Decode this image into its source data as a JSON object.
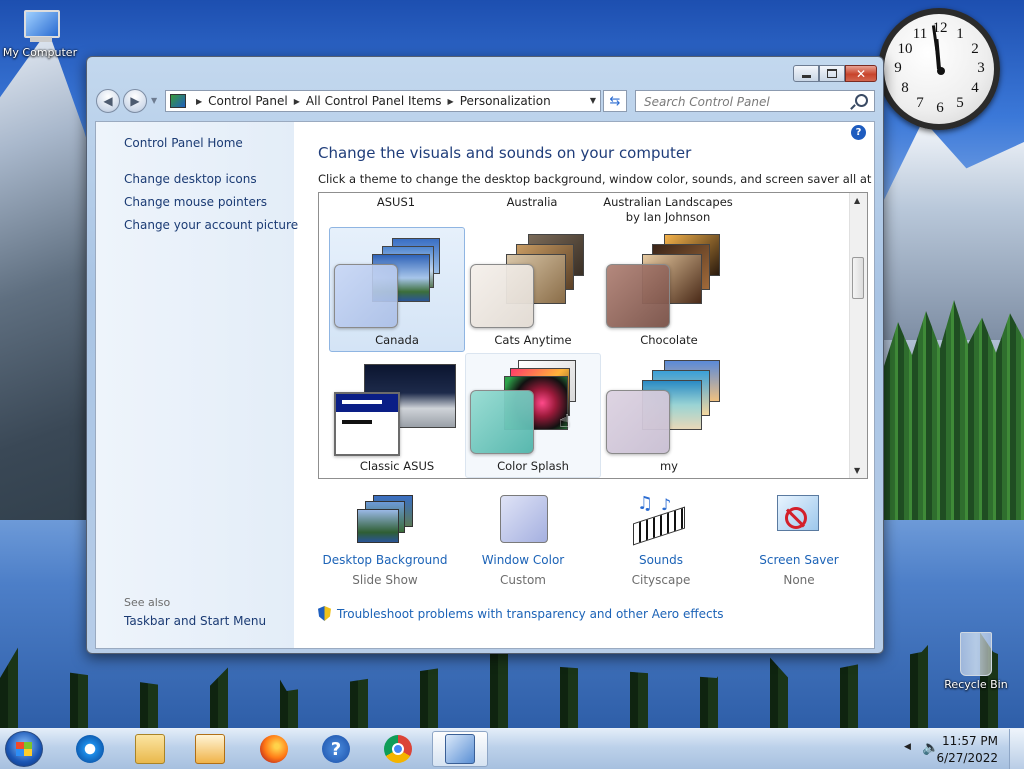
{
  "desktop": {
    "icons": [
      {
        "label": "My Computer"
      },
      {
        "label": "Recycle Bin"
      }
    ],
    "clock": {
      "numbers": [
        "12",
        "1",
        "2",
        "3",
        "4",
        "5",
        "6",
        "7",
        "8",
        "9",
        "10",
        "11"
      ]
    }
  },
  "window": {
    "breadcrumb": [
      "Control Panel",
      "All Control Panel Items",
      "Personalization"
    ],
    "search_placeholder": "Search Control Panel",
    "help_label": "?",
    "sidebar": {
      "home": "Control Panel Home",
      "links": [
        "Change desktop icons",
        "Change mouse pointers",
        "Change your account picture"
      ],
      "see_also_label": "See also",
      "see_also_links": [
        "Taskbar and Start Menu"
      ]
    },
    "main": {
      "title": "Change the visuals and sounds on your computer",
      "instructions": "Click a theme to change the desktop background, window color, sounds, and screen saver all at once.",
      "theme_categories": [
        "ASUS1",
        "Australia",
        "Australian Landscapes\nby Ian Johnson"
      ],
      "themes": [
        {
          "name": "Canada",
          "selected": true
        },
        {
          "name": "Cats Anytime",
          "selected": false
        },
        {
          "name": "Chocolate",
          "selected": false
        },
        {
          "name": "Classic ASUS",
          "selected": false
        },
        {
          "name": "Color Splash",
          "selected": false,
          "hovered": true
        },
        {
          "name": "my",
          "selected": false
        }
      ],
      "settings": [
        {
          "label": "Desktop Background",
          "value": "Slide Show"
        },
        {
          "label": "Window Color",
          "value": "Custom"
        },
        {
          "label": "Sounds",
          "value": "Cityscape"
        },
        {
          "label": "Screen Saver",
          "value": "None"
        }
      ],
      "troubleshoot_link": "Troubleshoot problems with transparency and other Aero effects"
    }
  },
  "taskbar": {
    "pinned": [
      "internet-explorer",
      "windows-explorer",
      "media-player",
      "firefox",
      "help",
      "chrome",
      "control-panel"
    ],
    "active": "control-panel",
    "time": "11:57 PM",
    "date": "6/27/2022"
  },
  "colors": {
    "link": "#1c63b7",
    "title": "#1f3d7a",
    "selection": "#d4e4f6"
  }
}
